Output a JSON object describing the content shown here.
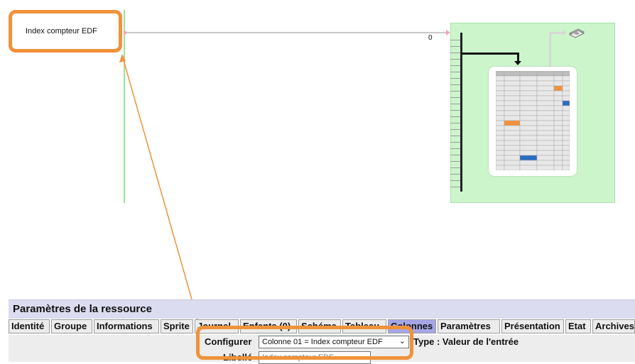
{
  "diagram": {
    "source_node_label": "Index compteur EDF",
    "link_value": "0"
  },
  "params": {
    "title": "Paramètres de la ressource",
    "tabs": [
      "Identité",
      "Groupe",
      "Informations",
      "Sprite",
      "Journal",
      "Enfants (0)",
      "Schéma",
      "Tableau",
      "Colonnes",
      "Paramètres",
      "Présentation",
      "Etat",
      "Archives"
    ],
    "active_tab": "Colonnes",
    "configurer_label": "Configurer",
    "configurer_value": "Colonne 01 = Index compteur EDF",
    "type_text": "Type : Valeur de l'entrée",
    "libelle_label": "Libellé",
    "libelle_value": "Index compteur EDF"
  },
  "colors": {
    "highlight": "#f0923a",
    "panel_green": "#ccf5cc",
    "active_tab": "#a6a6e6",
    "header": "#dcdcf0"
  },
  "icons": [
    "money-icon",
    "chevron-down-icon"
  ]
}
